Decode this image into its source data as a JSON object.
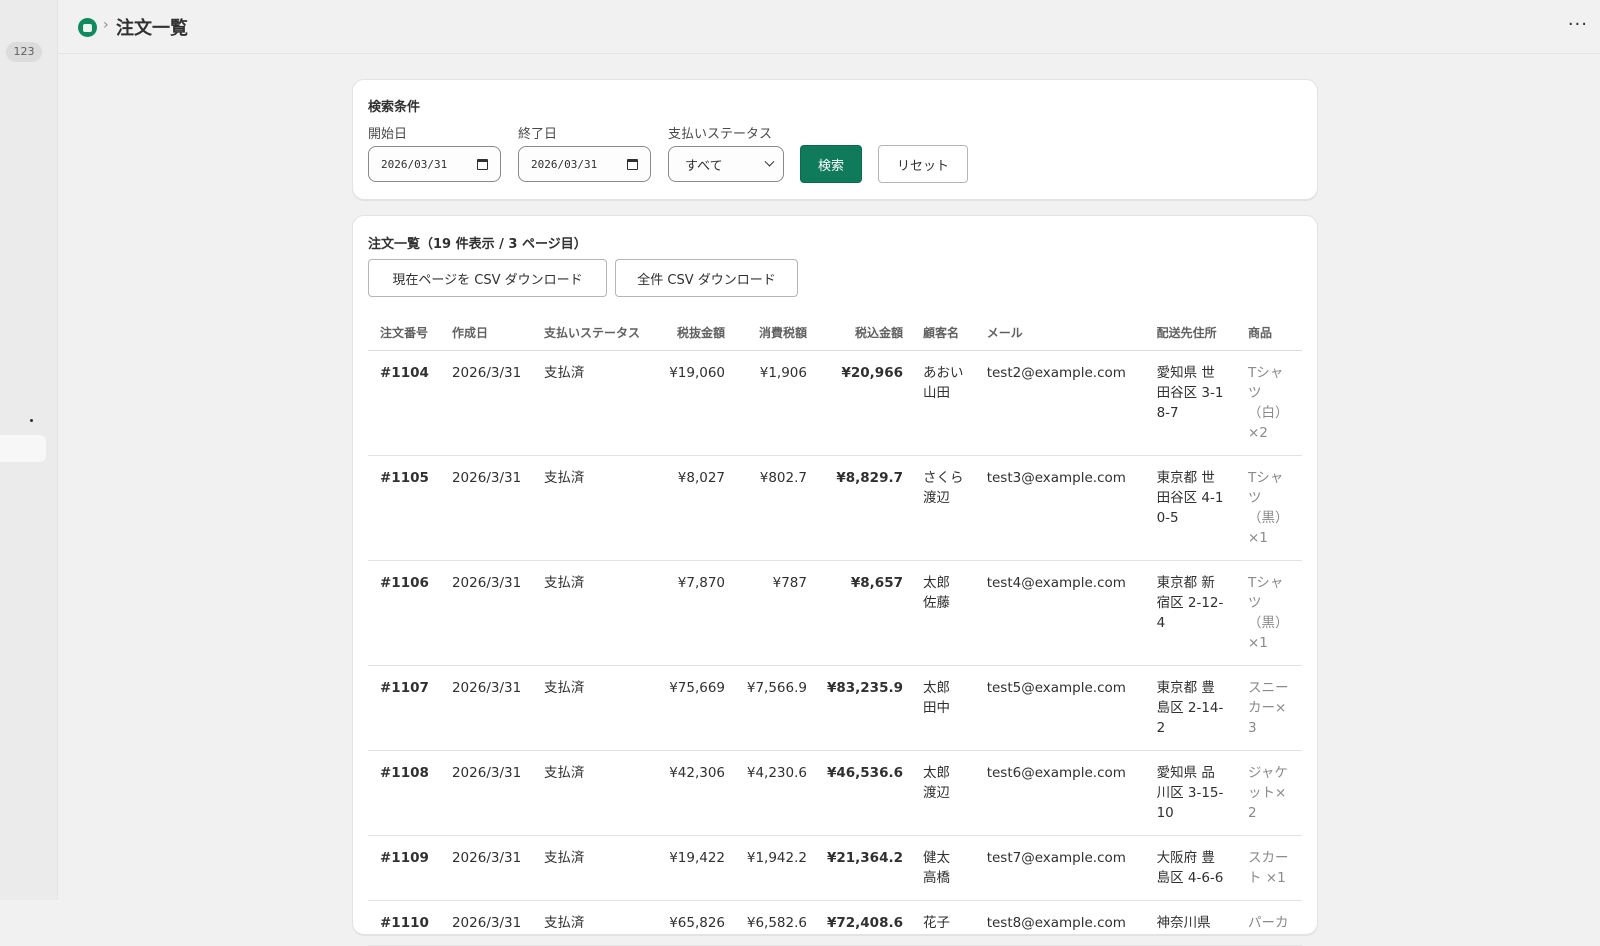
{
  "rail": {
    "badge": "123"
  },
  "header": {
    "title": "注文一覧",
    "more": "···"
  },
  "search": {
    "heading": "検索条件",
    "start_label": "開始日",
    "start_value": "2026/03/31",
    "end_label": "終了日",
    "end_value": "2026/03/31",
    "status_label": "支払いステータス",
    "status_value": "すべて",
    "search_button": "検索",
    "reset_button": "リセット"
  },
  "list": {
    "heading": "注文一覧（19 件表示 / 3 ページ目）",
    "csv_page_button": "現在ページを CSV ダウンロード",
    "csv_all_button": "全件 CSV ダウンロード",
    "columns": [
      "注文番号",
      "作成日",
      "支払いステータス",
      "税抜金額",
      "消費税額",
      "税込金額",
      "顧客名",
      "メール",
      "配送先住所",
      "商品"
    ],
    "rows": [
      [
        "#1104",
        "2026/3/31",
        "支払済",
        "¥19,060",
        "¥1,906",
        "¥20,966",
        "あおい 山田",
        "test2@example.com",
        "愛知県 世田谷区 3-18-7",
        "Tシャツ（白）×2"
      ],
      [
        "#1105",
        "2026/3/31",
        "支払済",
        "¥8,027",
        "¥802.7",
        "¥8,829.7",
        "さくら 渡辺",
        "test3@example.com",
        "東京都 世田谷区 4-10-5",
        "Tシャツ（黒）×1"
      ],
      [
        "#1106",
        "2026/3/31",
        "支払済",
        "¥7,870",
        "¥787",
        "¥8,657",
        "太郎 佐藤",
        "test4@example.com",
        "東京都 新宿区 2-12-4",
        "Tシャツ（黒）×1"
      ],
      [
        "#1107",
        "2026/3/31",
        "支払済",
        "¥75,669",
        "¥7,566.9",
        "¥83,235.9",
        "太郎 田中",
        "test5@example.com",
        "東京都 豊島区 2-14-2",
        "スニーカー×3"
      ],
      [
        "#1108",
        "2026/3/31",
        "支払済",
        "¥42,306",
        "¥4,230.6",
        "¥46,536.6",
        "太郎 渡辺",
        "test6@example.com",
        "愛知県 品川区 3-15-10",
        "ジャケット×2"
      ],
      [
        "#1109",
        "2026/3/31",
        "支払済",
        "¥19,422",
        "¥1,942.2",
        "¥21,364.2",
        "健太 高橋",
        "test7@example.com",
        "大阪府 豊島区 4-6-6",
        "スカート ×1"
      ],
      [
        "#1110",
        "2026/3/31",
        "支払済",
        "¥65,826",
        "¥6,582.6",
        "¥72,408.6",
        "花子",
        "test8@example.com",
        "神奈川県",
        "パーカ"
      ]
    ]
  }
}
